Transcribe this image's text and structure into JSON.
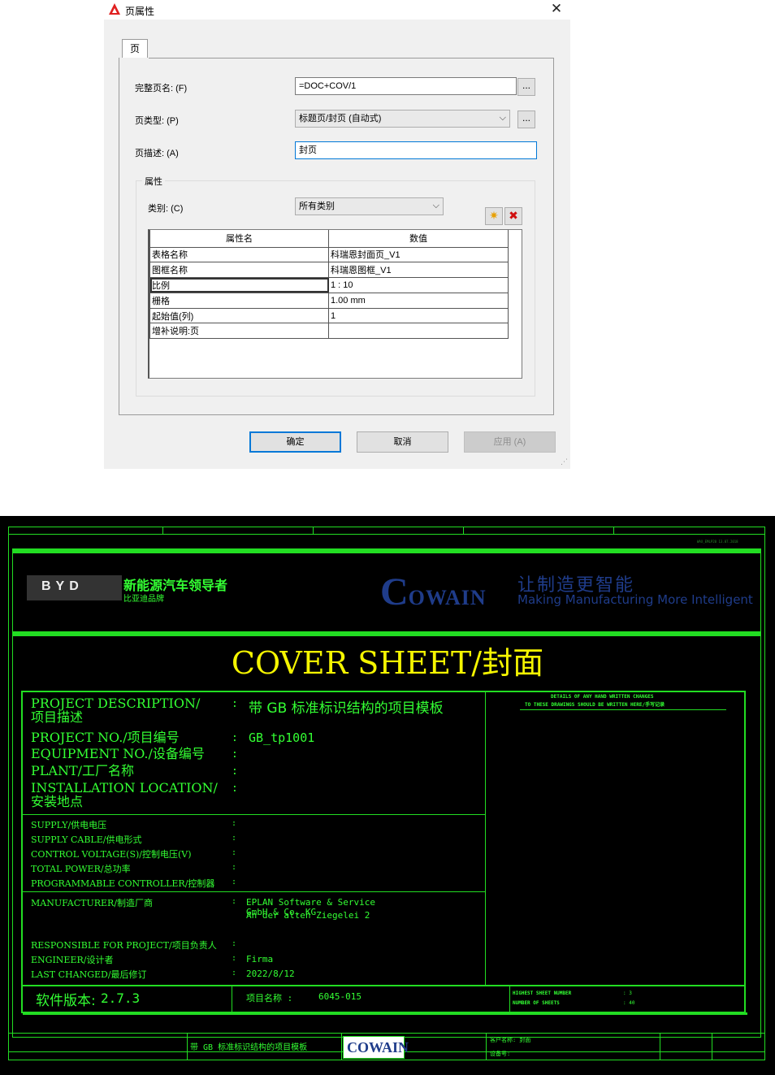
{
  "dialog": {
    "title": "页属性",
    "tab": "页",
    "fields": {
      "full_name_label": "完整页名: (F)",
      "full_name_value": "=DOC+COV/1",
      "type_label": "页类型: (P)",
      "type_value": "标题页/封页 (自动式)",
      "desc_label": "页描述: (A)",
      "desc_value": "封页",
      "dots": "..."
    },
    "group_title": "属性",
    "category_label": "类别: (C)",
    "category_value": "所有类别",
    "new_icon": "✷",
    "delete_icon": "✖",
    "table": {
      "headers": [
        "属性名",
        "数值"
      ],
      "rows": [
        [
          "表格名称",
          "科瑞恩封面页_V1"
        ],
        [
          "图框名称",
          "科瑞恩图框_V1"
        ],
        [
          "比例",
          "1 : 10"
        ],
        [
          "栅格",
          "1.00 mm"
        ],
        [
          "起始值(列)",
          "1"
        ],
        [
          "增补说明:页",
          ""
        ]
      ]
    },
    "buttons": {
      "ok": "确定",
      "cancel": "取消",
      "apply": "应用 (A)"
    },
    "close_glyph": "✕",
    "grip_glyph": "⋰"
  },
  "cover": {
    "top_right_meta": "WAX_EMLP20   13.07.2018",
    "byd": {
      "logo": "BYD",
      "slogan": "新能源汽车领导者",
      "sub": "比亚迪品牌"
    },
    "cowain": {
      "logo_c": "C",
      "logo_rest": "OWAIN",
      "slogan_cn": "让制造更智能",
      "slogan_en": "Making Manufacturing More Intelligent"
    },
    "title": "COVER SHEET/封面",
    "project_desc_label": "PROJECT DESCRIPTION/",
    "project_desc_label2": "项目描述",
    "project_desc_value": "带 GB 标准标识结构的项目模板",
    "project_no_label": "PROJECT NO./项目编号",
    "project_no_value": "GB_tp1001",
    "equipment_no_label": "EQUIPMENT NO./设备编号",
    "plant_label": "PLANT/工厂名称",
    "install_label": "INSTALLATION LOCATION/",
    "install_label2": "安装地点",
    "supply_label": "SUPPLY/供电电压",
    "supply_cable_label": "SUPPLY CABLE/供电形式",
    "control_voltage_label": "CONTROL VOLTAGE(S)/控制电压(V)",
    "total_power_label": "TOTAL POWER/总功率",
    "plc_label": "PROGRAMMABLE CONTROLLER/控制器",
    "manufacturer_label": "MANUFACTURER/制造厂商",
    "manufacturer_value1": "EPLAN Software & Service",
    "manufacturer_value2": "GmbH & Co. KG",
    "manufacturer_value3": "An der alten Ziegelei 2",
    "responsible_label": "RESPONSIBLE FOR PROJECT/项目负责人",
    "engineer_label": "ENGINEER/设计者",
    "engineer_value": "Firma",
    "last_changed_label": "LAST CHANGED/最后修订",
    "last_changed_value": "2022/8/12",
    "colon": ":",
    "details_line1": "DETAILS OF ANY HAND WRITTEN CHANGES",
    "details_line2": "TO THESE DRAWINGS SHOULD BE WRITTEN HERE/手写记录",
    "software_version_label": "软件版本:",
    "software_version_value": "2.7.3",
    "project_name_label": "项目名称 :",
    "project_name_value": "6045-015",
    "highest_sheet_label": "HIGHEST SHEET NUMBER",
    "highest_sheet_value": ": 3",
    "number_sheets_label": "NUMBER OF SHEETS",
    "number_sheets_value": ": 40",
    "footer_desc": "带 GB 标准标识结构的项目模板",
    "footer_logo": "COWAIN",
    "footer_customer": "客户名称:  封面",
    "footer_device": "设备号:"
  },
  "colors": {
    "dialog_bg": "#f0f0f0",
    "accent": "#0078d7",
    "cover_green": "#33ff33",
    "cover_title": "#f5f500",
    "cowain_blue": "#1f3c8a"
  }
}
